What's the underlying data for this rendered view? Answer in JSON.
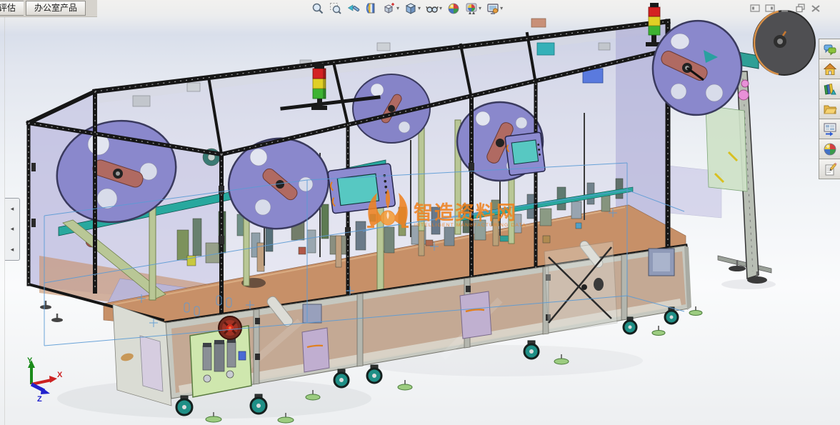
{
  "command_tabs": {
    "items": [
      {
        "label": "评估",
        "partially_visible": true
      },
      {
        "label": "办公室产品",
        "partially_visible": false
      }
    ]
  },
  "headsup_toolbar": {
    "tools": [
      {
        "name": "zoom-to-fit",
        "has_dropdown": false
      },
      {
        "name": "zoom-to-area",
        "has_dropdown": false
      },
      {
        "name": "previous-view",
        "has_dropdown": false
      },
      {
        "name": "section-view",
        "has_dropdown": false
      },
      {
        "name": "view-orientation",
        "has_dropdown": true
      },
      {
        "name": "display-style",
        "has_dropdown": true
      },
      {
        "name": "hide-show-items",
        "has_dropdown": true
      },
      {
        "name": "edit-appearance",
        "has_dropdown": false
      },
      {
        "name": "apply-scene",
        "has_dropdown": true
      },
      {
        "name": "view-settings",
        "has_dropdown": true
      }
    ]
  },
  "window_controls": {
    "items": [
      {
        "name": "dock-pane-left"
      },
      {
        "name": "dock-pane-right"
      },
      {
        "name": "minimize"
      },
      {
        "name": "restore"
      },
      {
        "name": "close"
      }
    ]
  },
  "task_pane": {
    "items": [
      {
        "name": "solidworks-forum"
      },
      {
        "name": "solidworks-resources"
      },
      {
        "name": "design-library"
      },
      {
        "name": "file-explorer"
      },
      {
        "name": "view-palette"
      },
      {
        "name": "appearances-scenes"
      },
      {
        "name": "custom-properties"
      }
    ]
  },
  "viewport": {
    "watermark": {
      "title": "智造资料网",
      "subtitle": "INTELLIGENT MANUFACTURING DATA",
      "color": "#ef8220"
    },
    "triad": {
      "labels": {
        "x": "X",
        "y": "Y",
        "z": "Z"
      },
      "colors": {
        "x": "#cc2222",
        "y": "#1a8a1a",
        "z": "#2222cc"
      }
    },
    "model": {
      "name": "automated-assembly-line-machine",
      "palette": {
        "frame": "#161616",
        "panel_glass": "#b4b2d9",
        "reel": "#8a88cc",
        "reel_hub": "#b06a62",
        "table": "#c79068",
        "cabinet": "#c3c5bd",
        "cabinet_interior": "#b5886a",
        "pneumatic_panel": "#cfe7ae",
        "conveyor": "#28a89e",
        "belt_strip": "#b9c796",
        "tower_red": "#d42222",
        "tower_yellow": "#e0cf25",
        "tower_green": "#3db332",
        "hmi_body": "#8d8bd0",
        "hmi_screen": "#57c8c2",
        "caster_wheel": "#1f8f86",
        "leveling_pad": "#9ccc80",
        "sketch_line": "#5b9bd5"
      }
    }
  }
}
